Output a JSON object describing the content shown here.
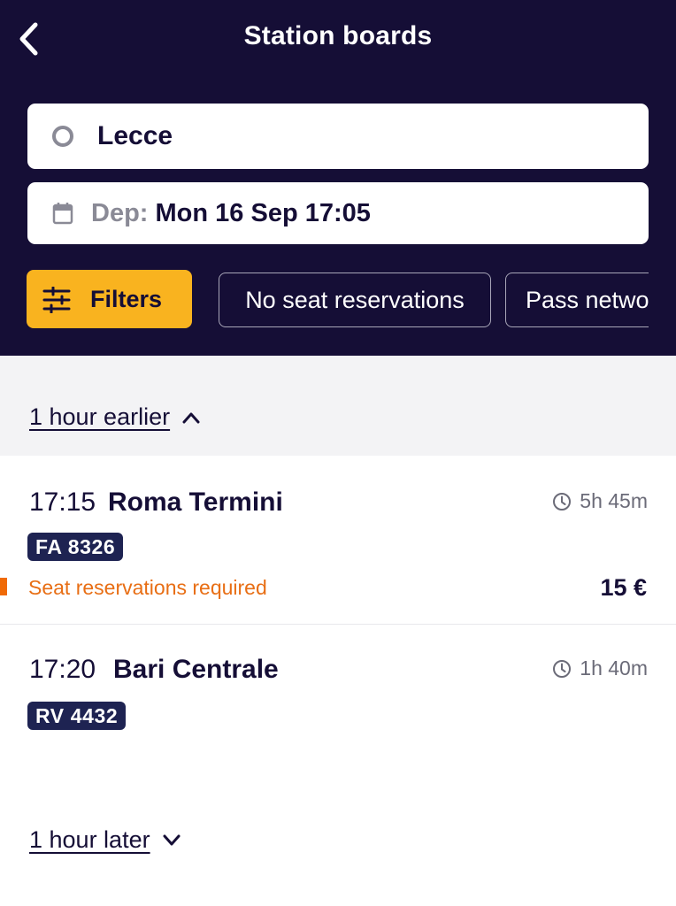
{
  "header": {
    "title": "Station boards",
    "back_icon": "chevron-left-icon",
    "background": "#150e36"
  },
  "search": {
    "station": "Lecce",
    "date_label": "Dep:",
    "date_value": "Mon 16 Sep 17:05"
  },
  "filters": {
    "filters_label": "Filters",
    "chips": [
      "No seat reservations",
      "Pass netwo"
    ],
    "accent": "#f9b31f"
  },
  "earlier": {
    "label": "1 hour earlier",
    "icon": "chevron-up-icon"
  },
  "later": {
    "label": "1 hour later",
    "icon": "chevron-down-icon"
  },
  "departures": [
    {
      "time": "17:15",
      "destination": "Roma Termini",
      "duration": "5h 45m",
      "train": "FA 8326",
      "warning": "Seat reservations required",
      "price": "15 €"
    },
    {
      "time": "17:20",
      "destination": "Bari Centrale",
      "duration": "1h 40m",
      "train": "RV 4432"
    }
  ],
  "colors": {
    "warning": "#e86e14",
    "badge": "#1e2352"
  }
}
